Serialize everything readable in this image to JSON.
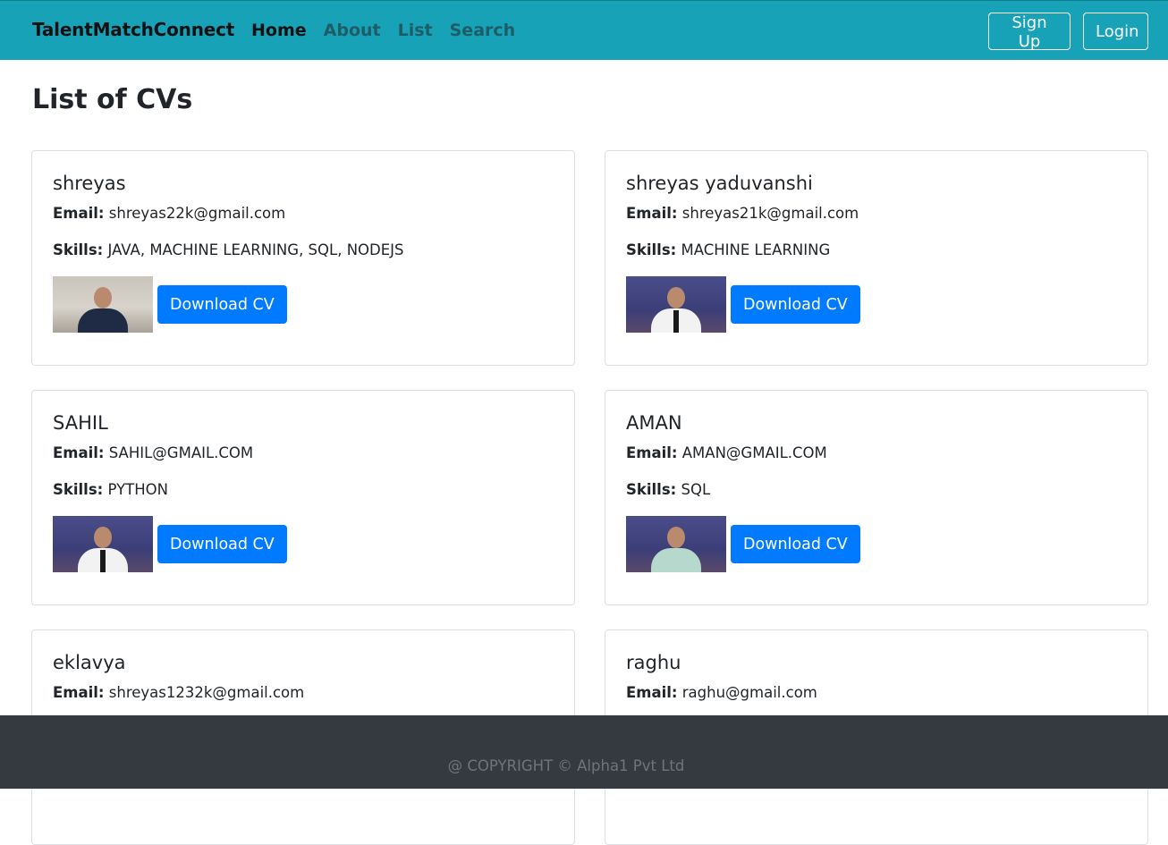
{
  "navbar": {
    "brand": "TalentMatchConnect",
    "links": [
      "Home",
      "About",
      "List",
      "Search"
    ],
    "signup_label": "Sign Up",
    "login_label": "Login"
  },
  "page": {
    "title": "List of CVs"
  },
  "labels": {
    "email": "Email:",
    "skills": "Skills:",
    "download": "Download CV"
  },
  "cvs": [
    {
      "name": "shreyas",
      "email": "shreyas22k@gmail.com",
      "skills": "JAVA, MACHINE LEARNING, SQL, NODEJS"
    },
    {
      "name": "shreyas yaduvanshi",
      "email": "shreyas21k@gmail.com",
      "skills": "MACHINE LEARNING"
    },
    {
      "name": "SAHIL",
      "email": "SAHIL@GMAIL.COM",
      "skills": "PYTHON"
    },
    {
      "name": "AMAN",
      "email": "AMAN@GMAIL.COM",
      "skills": "SQL"
    },
    {
      "name": "eklavya",
      "email": "shreyas1232k@gmail.com",
      "skills": ""
    },
    {
      "name": "raghu",
      "email": "raghu@gmail.com",
      "skills": ""
    }
  ],
  "footer": {
    "text": "@ COPYRIGHT © Alpha1 Pvt Ltd"
  },
  "colors": {
    "navbar": "#17a2b8",
    "primary_button": "#007bff",
    "footer": "#343a40"
  }
}
